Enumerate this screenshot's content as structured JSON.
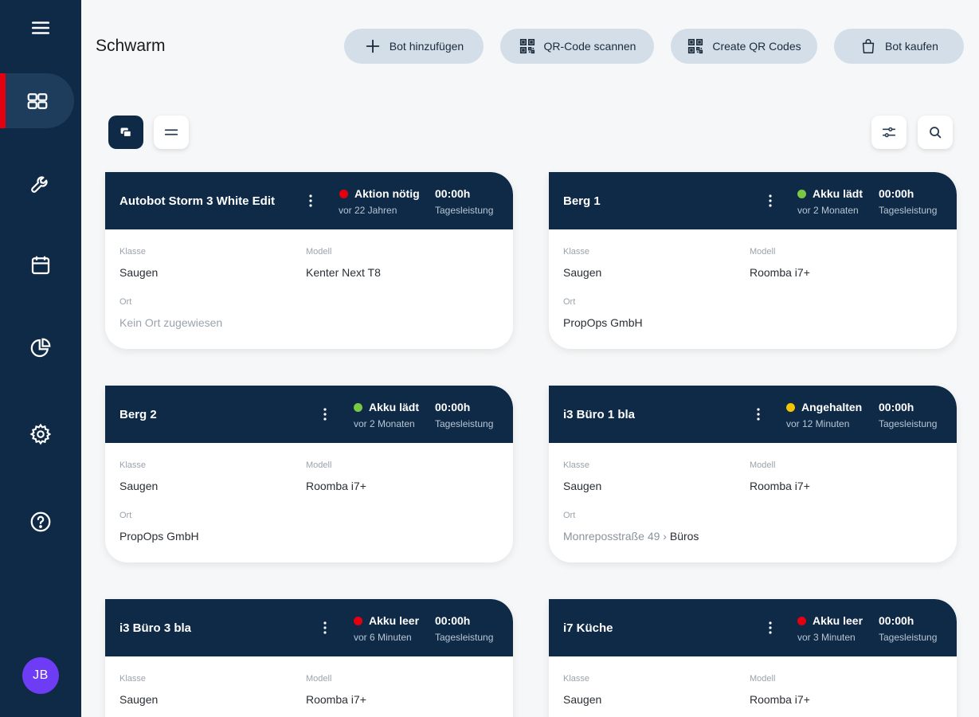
{
  "sidebar": {
    "items": [
      {
        "name": "menu",
        "icon": "hamburger-menu-icon"
      },
      {
        "name": "dashboard",
        "icon": "grid-icon",
        "active": true
      },
      {
        "name": "tools",
        "icon": "wrench-icon"
      },
      {
        "name": "calendar",
        "icon": "calendar-icon"
      },
      {
        "name": "statistics",
        "icon": "pie-chart-icon"
      },
      {
        "name": "settings",
        "icon": "gear-icon"
      },
      {
        "name": "help",
        "icon": "help-circle-icon"
      }
    ],
    "avatar_initials": "JB",
    "active_indicator_color": "#e3000f",
    "background_color": "#0f2a47"
  },
  "header": {
    "title": "Schwarm",
    "buttons": {
      "add_bot": "Bot hinzufügen",
      "scan_qr": "QR-Code scannen",
      "create_qr": "Create QR Codes",
      "buy_bot": "Bot kaufen"
    }
  },
  "labels": {
    "class": "Klasse",
    "model": "Modell",
    "location": "Ort",
    "daily_performance": "Tagesleistung"
  },
  "status_colors": {
    "red": "#e3000f",
    "green": "#7ac943",
    "yellow": "#f5c400"
  },
  "bots": [
    {
      "name": "Autobot Storm 3 White Edit",
      "status": "Aktion nötig",
      "status_color": "#e3000f",
      "status_time": "vor 22 Jahren",
      "daily_performance": "00:00h",
      "class": "Saugen",
      "model": "Kenter Next T8",
      "location": "Kein Ort zugewiesen",
      "location_assigned": false
    },
    {
      "name": "Berg 1",
      "status": "Akku lädt",
      "status_color": "#7ac943",
      "status_time": "vor 2 Monaten",
      "daily_performance": "00:00h",
      "class": "Saugen",
      "model": "Roomba i7+",
      "location": "PropOps GmbH",
      "location_assigned": true
    },
    {
      "name": "Berg 2",
      "status": "Akku lädt",
      "status_color": "#7ac943",
      "status_time": "vor 2 Monaten",
      "daily_performance": "00:00h",
      "class": "Saugen",
      "model": "Roomba i7+",
      "location": "PropOps GmbH",
      "location_assigned": true
    },
    {
      "name": "i3 Büro 1 bla",
      "status": "Angehalten",
      "status_color": "#f5c400",
      "status_time": "vor 12 Minuten",
      "daily_performance": "00:00h",
      "class": "Saugen",
      "model": "Roomba i7+",
      "location_path": [
        "Monreposstraße 49",
        "Büros"
      ],
      "location_assigned": true
    },
    {
      "name": "i3 Büro 3 bla",
      "status": "Akku leer",
      "status_color": "#e3000f",
      "status_time": "vor 6 Minuten",
      "daily_performance": "00:00h",
      "class": "Saugen",
      "model": "Roomba i7+"
    },
    {
      "name": "i7 Küche",
      "status": "Akku leer",
      "status_color": "#e3000f",
      "status_time": "vor 3 Minuten",
      "daily_performance": "00:00h",
      "class": "Saugen",
      "model": "Roomba i7+"
    }
  ],
  "view_mode": "grid"
}
